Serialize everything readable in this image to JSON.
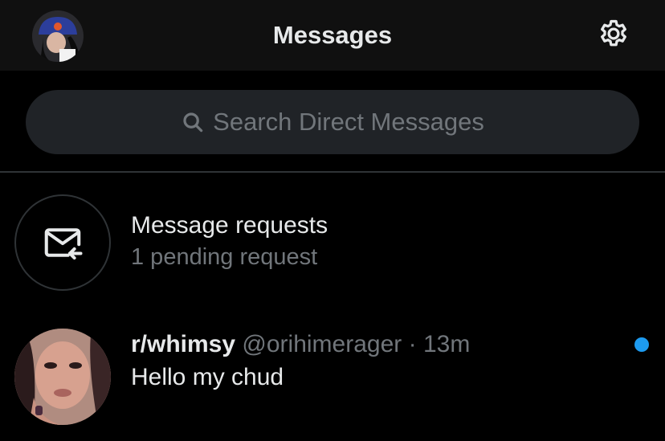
{
  "header": {
    "title": "Messages",
    "profile_avatar_icon": "profile-avatar",
    "settings_icon": "gear-icon"
  },
  "search": {
    "placeholder": "Search Direct Messages",
    "icon": "search-icon"
  },
  "requests": {
    "title": "Message requests",
    "subtitle": "1 pending request",
    "icon": "envelope-return-icon"
  },
  "conversations": [
    {
      "name": "r/whimsy",
      "handle": "@orihimerager",
      "separator": "·",
      "time": "13m",
      "preview": "Hello my chud",
      "unread": true
    }
  ],
  "colors": {
    "background": "#000000",
    "header_bg": "#101010",
    "search_bg": "#202327",
    "text_primary": "#e7e9ea",
    "text_secondary": "#71767b",
    "unread_dot": "#1d9bf0",
    "divider": "#2f3336"
  }
}
